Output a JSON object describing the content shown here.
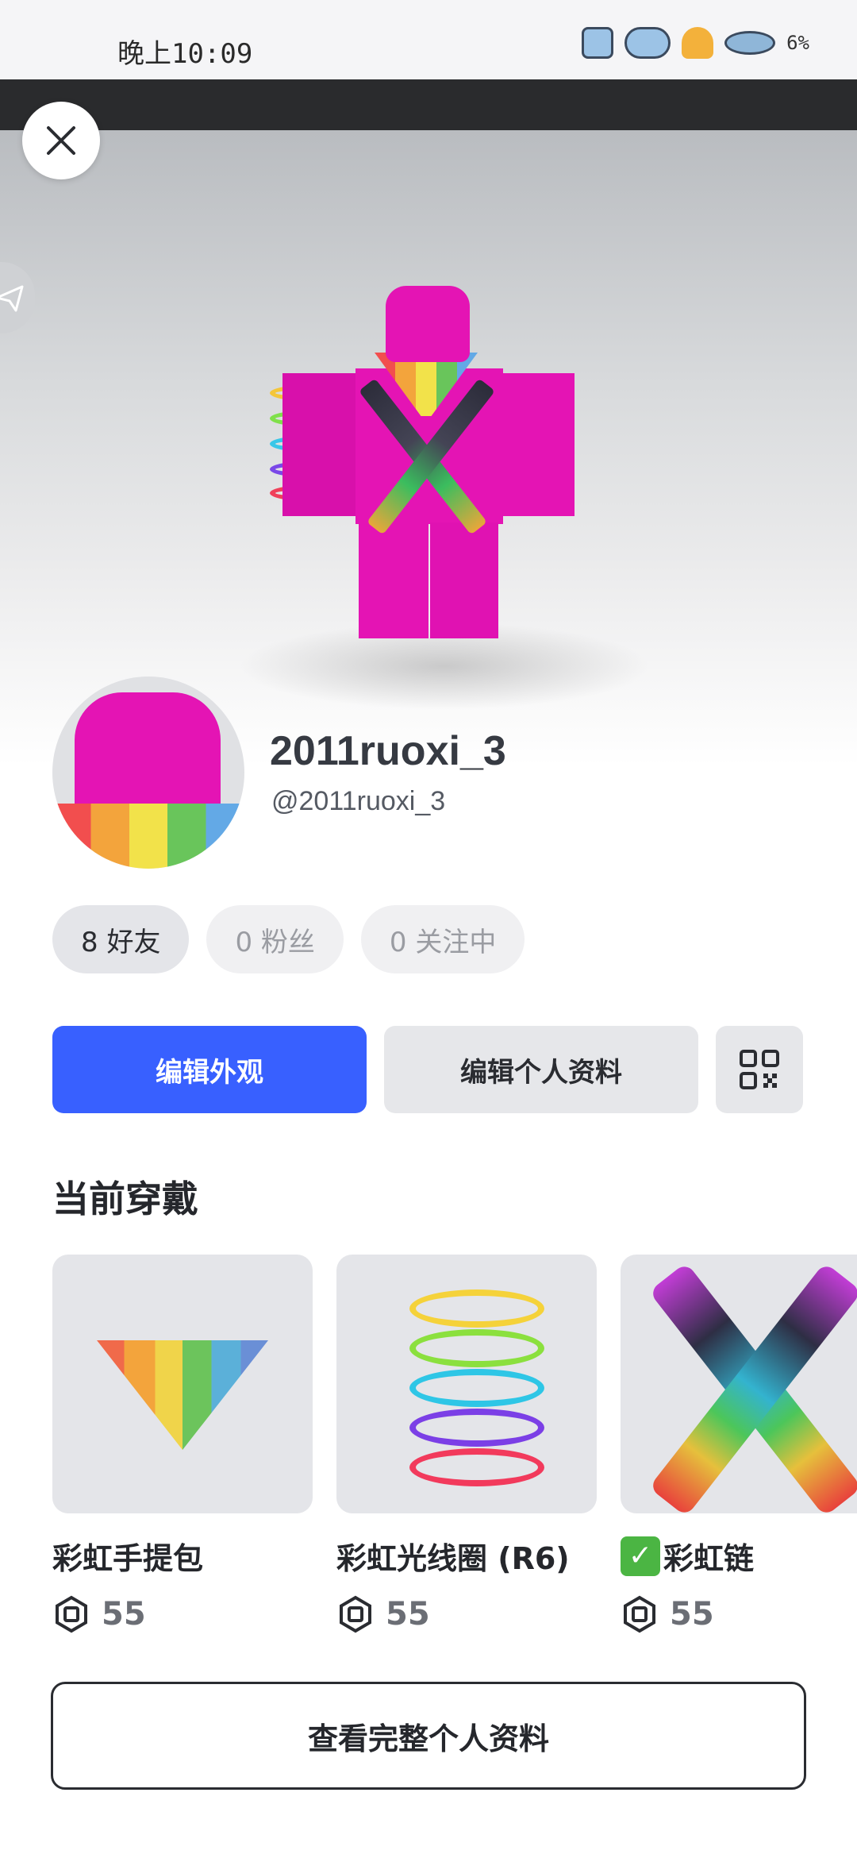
{
  "status_bar": {
    "time": "晚上10:09",
    "battery": "6%"
  },
  "profile": {
    "display_name": "2011ruoxi_3",
    "username": "@2011ruoxi_3"
  },
  "stats": [
    {
      "label": "8 好友"
    },
    {
      "label": "0 粉丝"
    },
    {
      "label": "0 关注中"
    }
  ],
  "actions": {
    "edit_avatar": "编辑外观",
    "edit_profile": "编辑个人资料"
  },
  "wearing": {
    "title": "当前穿戴",
    "items": [
      {
        "name": "彩虹手提包",
        "price": "55",
        "verified": false
      },
      {
        "name": "彩虹光线圈 (R6)",
        "price": "55",
        "verified": false
      },
      {
        "name": "彩虹链",
        "price": "55",
        "verified": true
      }
    ]
  },
  "footer": {
    "view_full_profile": "查看完整个人资料"
  },
  "colors": {
    "primary": "#3860ff",
    "avatar_pink": "#e414b4"
  }
}
